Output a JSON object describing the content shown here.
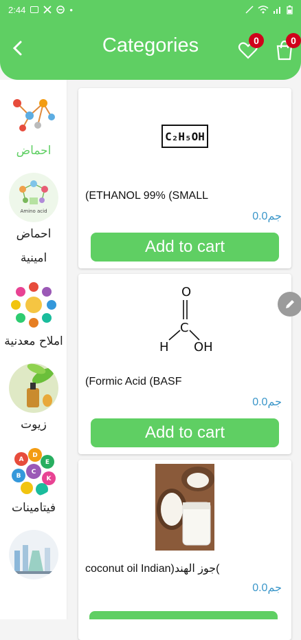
{
  "status_bar": {
    "time": "2:44",
    "dot": "•"
  },
  "header": {
    "title": "Categories",
    "wishlist_count": "0",
    "cart_count": "0"
  },
  "sidebar": {
    "items": [
      {
        "label": "احماض",
        "icon": "acid-molecule-icon"
      },
      {
        "label": "احماض امينية",
        "icon": "amino-acid-icon"
      },
      {
        "label": "املاح معدنية",
        "icon": "mineral-salts-icon"
      },
      {
        "label": "زيوت",
        "icon": "oil-bottle-icon"
      },
      {
        "label": "فيتامينات",
        "icon": "vitamins-icon"
      },
      {
        "label": "",
        "icon": "lab-equipment-icon"
      }
    ]
  },
  "products": [
    {
      "name": "(ETHANOL 99% (SMALL",
      "price": "جم0.0",
      "cart_label": "Add to cart",
      "image": "ethanol-formula"
    },
    {
      "name": "(Formic Acid (BASF",
      "price": "جم0.0",
      "cart_label": "Add to cart",
      "image": "formic-acid-structure"
    },
    {
      "name": "coconut oil  Indian)جوز الهند(",
      "price": "جم0.0",
      "cart_label": "Add to cart",
      "image": "coconut-photo"
    }
  ],
  "colors": {
    "accent": "#5fcf63",
    "price": "#3a96c9",
    "badge": "#d0021b"
  }
}
